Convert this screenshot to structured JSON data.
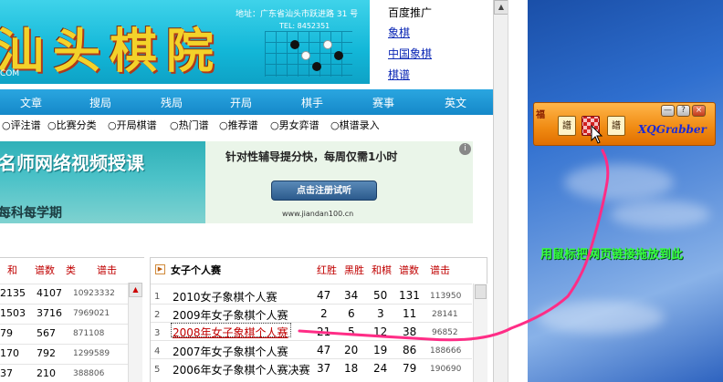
{
  "banner": {
    "title": "汕头棋院",
    "dotcom": "COM",
    "address": "地址：广东省汕头市跃进路 31 号",
    "tel": "TEL: 8452351"
  },
  "top_links": [
    "百度推广",
    "象棋",
    "中国象棋",
    "棋谱"
  ],
  "nav": [
    "文章",
    "搜局",
    "残局",
    "开局",
    "棋手",
    "赛事",
    "英文"
  ],
  "subnav": [
    "○评注谱",
    "○比赛分类",
    "○开局棋谱",
    "○热门谱",
    "○推荐谱",
    "○男女弈谱",
    "○棋谱录入"
  ],
  "ad": {
    "headline": "名师网络视频授课",
    "subline": "每科每学期",
    "tagline": "针对性辅导提分快，每周仅需1小时",
    "button": "点击注册试听",
    "url": "www.jiandan100.cn",
    "info_icon": "i"
  },
  "left_table": {
    "headers": [
      "和",
      "谱数",
      "类",
      "谱击"
    ],
    "rows": [
      [
        "2135",
        "4107",
        "10923332"
      ],
      [
        "1503",
        "3716",
        "7969021"
      ],
      [
        "79",
        "567",
        "871108"
      ],
      [
        "170",
        "792",
        "1299589"
      ],
      [
        "37",
        "210",
        "388806"
      ]
    ],
    "scroll_arrow": "▲"
  },
  "right_table": {
    "title": "女子个人赛",
    "headers": [
      "红胜",
      "黑胜",
      "和棋",
      "谱数",
      "谱击"
    ],
    "rows": [
      {
        "idx": "1",
        "name": "2010女子象棋个人赛",
        "red": "47",
        "black": "34",
        "draw": "50",
        "games": "131",
        "hits": "113950"
      },
      {
        "idx": "2",
        "name": "2009年女子象棋个人赛",
        "red": "2",
        "black": "6",
        "draw": "3",
        "games": "11",
        "hits": "28141"
      },
      {
        "idx": "3",
        "name": "2008年女子象棋个人赛",
        "red": "21",
        "black": "5",
        "draw": "12",
        "games": "38",
        "hits": "96852"
      },
      {
        "idx": "4",
        "name": "2007年女子象棋个人赛",
        "red": "47",
        "black": "20",
        "draw": "19",
        "games": "86",
        "hits": "188666"
      },
      {
        "idx": "5",
        "name": "2006年女子象棋个人赛决赛",
        "red": "37",
        "black": "18",
        "draw": "24",
        "games": "79",
        "hits": "190690"
      }
    ]
  },
  "xqgrabber": {
    "name": "XQGrabber",
    "logo": "福",
    "icon1": "譜",
    "icon3": "譜",
    "buttons": [
      "—",
      "?",
      "×"
    ]
  },
  "desktop_hint": "用鼠标把网页链接拖放到此",
  "colors": {
    "nav_bg": "#1a8fd0",
    "header_red": "#c00000",
    "link_blue": "#0b27b5",
    "hint_green": "#35ff3a",
    "drag_line": "#ff2d86",
    "widget_orange": "#f08a12"
  }
}
